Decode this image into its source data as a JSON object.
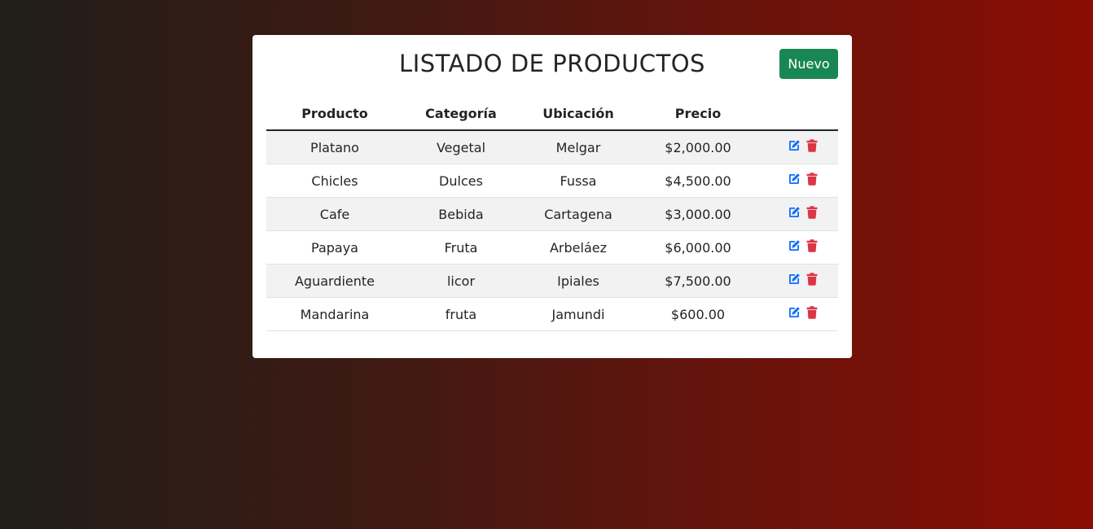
{
  "page": {
    "title": "LISTADO DE PRODUCTOS",
    "new_button_label": "Nuevo"
  },
  "colors": {
    "new_button": "#198754",
    "edit_icon": "#0d6efd",
    "delete_icon": "#dc3545"
  },
  "table": {
    "columns": [
      "Producto",
      "Categoría",
      "Ubicación",
      "Precio",
      ""
    ],
    "rows": [
      {
        "producto": "Platano",
        "categoria": "Vegetal",
        "ubicacion": "Melgar",
        "precio": "$2,000.00",
        "edit_icon": "edit-icon",
        "delete_icon": "trash-icon"
      },
      {
        "producto": "Chicles",
        "categoria": "Dulces",
        "ubicacion": "Fussa",
        "precio": "$4,500.00",
        "edit_icon": "edit-icon",
        "delete_icon": "trash-icon"
      },
      {
        "producto": "Cafe",
        "categoria": "Bebida",
        "ubicacion": "Cartagena",
        "precio": "$3,000.00",
        "edit_icon": "edit-icon",
        "delete_icon": "trash-icon"
      },
      {
        "producto": "Papaya",
        "categoria": "Fruta",
        "ubicacion": "Arbeláez",
        "precio": "$6,000.00",
        "edit_icon": "edit-icon",
        "delete_icon": "trash-icon"
      },
      {
        "producto": "Aguardiente",
        "categoria": "licor",
        "ubicacion": "Ipiales",
        "precio": "$7,500.00",
        "edit_icon": "edit-icon",
        "delete_icon": "trash-icon"
      },
      {
        "producto": "Mandarina",
        "categoria": "fruta",
        "ubicacion": "Jamundi",
        "precio": "$600.00",
        "edit_icon": "edit-icon",
        "delete_icon": "trash-icon"
      }
    ]
  }
}
